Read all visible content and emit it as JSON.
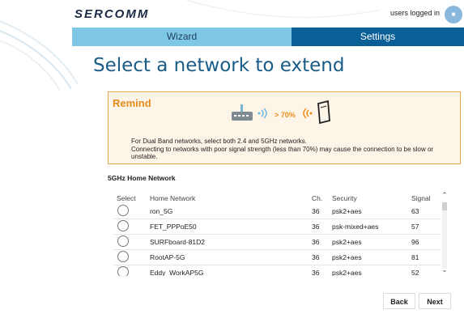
{
  "brand": {
    "logo": "SERCOMM"
  },
  "header": {
    "user_status": "users logged in"
  },
  "tabs": [
    {
      "label": "Wizard"
    },
    {
      "label": "Settings"
    }
  ],
  "page": {
    "title": "Select a network to extend"
  },
  "remind": {
    "title": "Remind",
    "threshold": "> 70%",
    "line1": "For Dual Band networks, select both 2.4 and 5GHz networks.",
    "line2": "Connecting to networks with poor signal strength (less than 70%) may cause the connection to be slow or unstable."
  },
  "section": {
    "title": "5GHz Home Network"
  },
  "table": {
    "headers": {
      "select": "Select",
      "name": "Home Network",
      "channel": "Ch.",
      "security": "Security",
      "signal": "Signal"
    },
    "rows": [
      {
        "name": "ron_5G",
        "channel": "36",
        "security": "psk2+aes",
        "signal": "63"
      },
      {
        "name": "FET_PPPoE50",
        "channel": "36",
        "security": "psk-mixed+aes",
        "signal": "57"
      },
      {
        "name": "SURFboard-81D2",
        "channel": "36",
        "security": "psk2+aes",
        "signal": "96"
      },
      {
        "name": "RootAP-5G",
        "channel": "36",
        "security": "psk2+aes",
        "signal": "81"
      },
      {
        "name": "Eddy_WorkAP5G",
        "channel": "36",
        "security": "psk2+aes",
        "signal": "52"
      }
    ]
  },
  "buttons": {
    "back": "Back",
    "next": "Next"
  }
}
